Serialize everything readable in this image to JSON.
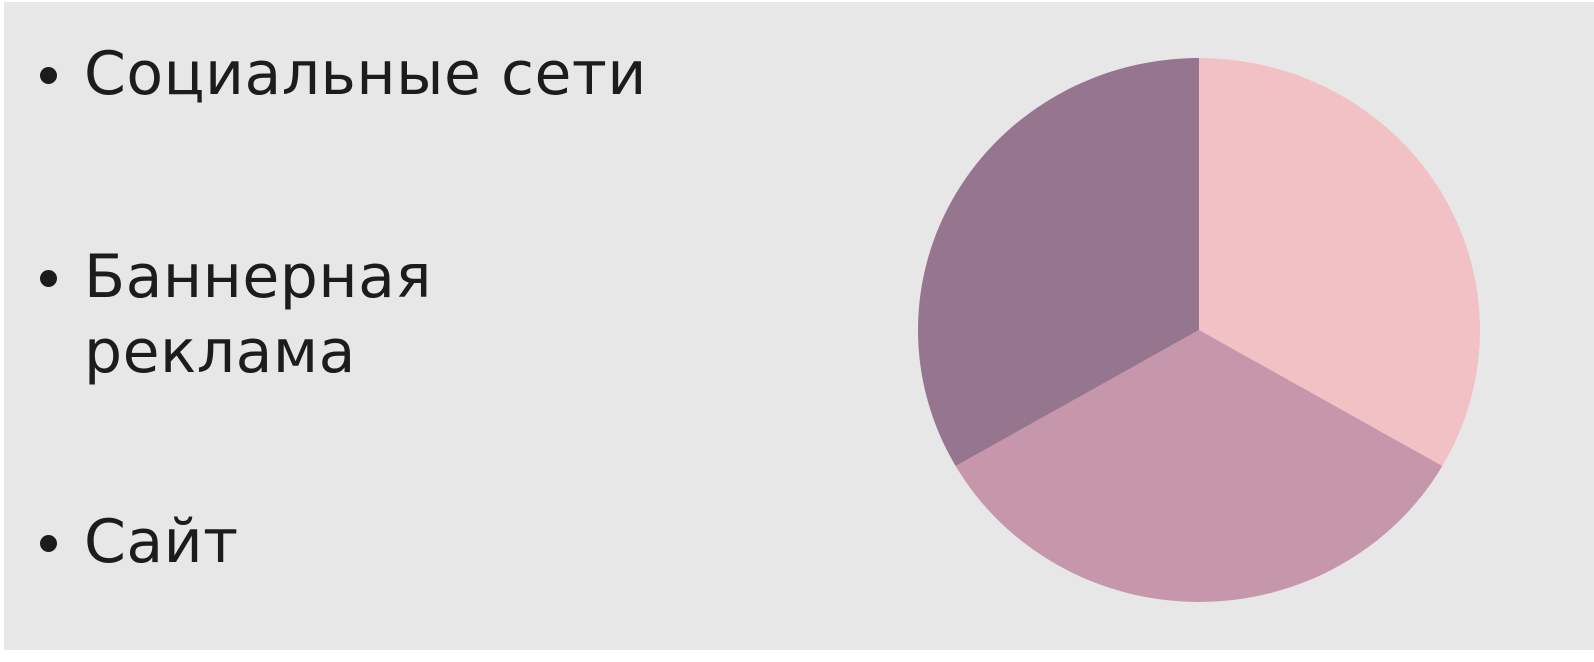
{
  "slide": {
    "bullets": [
      {
        "label": "Социальные сети"
      },
      {
        "label": "Баннерная\nреклама"
      },
      {
        "label": "Сайт"
      }
    ]
  },
  "chart_data": {
    "type": "pie",
    "title": "",
    "categories": [
      "Социальные сети",
      "Баннерная реклама",
      "Сайт"
    ],
    "values": [
      33.3,
      33.3,
      33.3
    ],
    "colors": [
      "#f2c1c5",
      "#c696ab",
      "#96758f"
    ],
    "start_angle_deg": 0,
    "direction": "clockwise",
    "legend": "none"
  }
}
